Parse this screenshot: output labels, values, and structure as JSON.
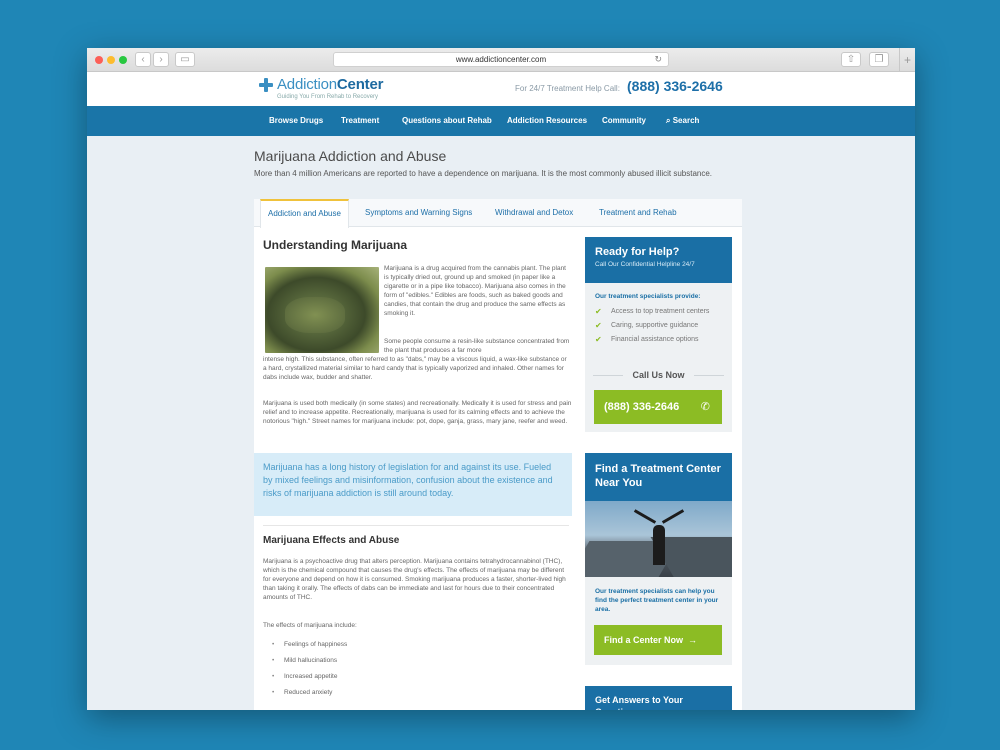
{
  "browser": {
    "url": "www.addictioncenter.com"
  },
  "site": {
    "logo_part1": "Addiction",
    "logo_part2": "Center",
    "tagline": "Guiding You From Rehab to Recovery",
    "helpline_label": "For 24/7 Treatment Help Call:",
    "helpline_number": "(888) 336-2646"
  },
  "nav": {
    "items": [
      "Browse Drugs",
      "Treatment",
      "Questions about Rehab",
      "Addiction Resources",
      "Community",
      "Search"
    ]
  },
  "page": {
    "title": "Marijuana Addiction and Abuse",
    "description": "More than 4 million Americans are reported to have a dependence on marijuana. It is the most commonly abused illicit substance."
  },
  "tabs": [
    "Addiction and Abuse",
    "Symptoms and Warning Signs",
    "Withdrawal and Detox",
    "Treatment and Rehab"
  ],
  "article": {
    "heading": "Understanding Marijuana",
    "para1": "Marijuana is a drug acquired from the cannabis plant. The plant is typically dried out, ground up and smoked (in paper like a cigarette or in a pipe like tobacco). Marijuana also comes in the form of \"edibles.\" Edibles are foods, such as baked goods and candies, that contain the drug and produce the same effects as smoking it.",
    "para2a": "Some people consume a resin-like substance concentrated from the plant that produces a far more",
    "para2b": "intense high. This substance, often referred to as \"dabs,\" may be a viscous liquid, a wax-like substance or a hard, crystallized material similar to hard candy that is typically vaporized and inhaled. Other names for dabs include wax, budder and shatter.",
    "para3": "Marijuana is used both medically (in some states) and recreationally. Medically it is used for stress and pain relief and to increase appetite. Recreationally, marijuana is used for its calming effects and to achieve the notorious \"high.\" Street names for marijuana include: pot, dope, ganja, grass, mary jane, reefer and weed.",
    "quote": "Marijuana has a long history of legislation for and against its use. Fueled by mixed feelings and misinformation, confusion about the existence and risks of marijuana addiction is still around today.",
    "subheading": "Marijuana Effects and Abuse",
    "para4": "Marijuana is a psychoactive drug that alters perception. Marijuana contains tetrahydrocannabinol (THC), which is the chemical compound that causes the drug's effects. The effects of marijuana may be different for everyone and depend on how it is consumed. Smoking marijuana produces a faster, shorter-lived high than taking it orally. The effects of dabs can be immediate and last for hours due to their concentrated amounts of THC.",
    "effects_intro": "The effects of marijuana include:",
    "effects": [
      "Feelings of happiness",
      "Mild hallucinations",
      "Increased appetite",
      "Reduced anxiety"
    ]
  },
  "sidebar": {
    "help_title": "Ready for Help?",
    "help_sub": "Call Our Confidential Helpline 24/7",
    "provide_label": "Our treatment specialists provide:",
    "provide_items": [
      "Access to top treatment centers",
      "Caring, supportive guidance",
      "Financial assistance options"
    ],
    "call_now": "Call Us Now",
    "call_number": "(888) 336-2646",
    "find_title": "Find a Treatment Center Near You",
    "find_text": "Our treatment specialists can help you find the perfect treatment center in your area.",
    "find_button": "Find a Center Now",
    "answers_title": "Get Answers to Your Questions:"
  }
}
